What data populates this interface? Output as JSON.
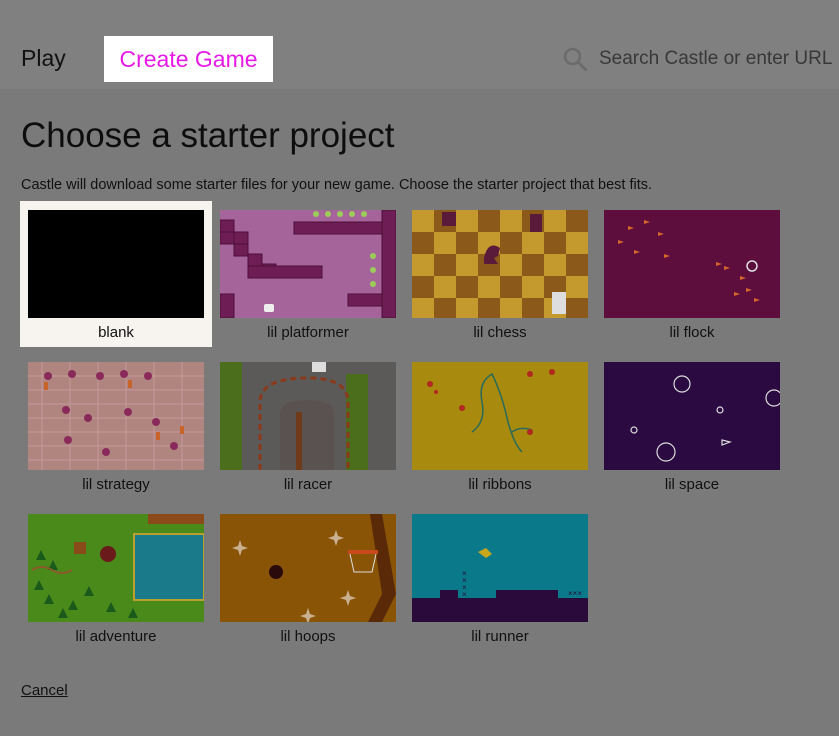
{
  "nav": {
    "play_label": "Play",
    "create_label": "Create Game",
    "search_placeholder": "Search Castle or enter URL"
  },
  "page": {
    "title": "Choose a starter project",
    "subtitle": "Castle will download some starter files for your new game. Choose the starter project that best fits.",
    "cancel_label": "Cancel"
  },
  "projects": [
    {
      "label": "blank",
      "selected": true
    },
    {
      "label": "lil platformer"
    },
    {
      "label": "lil chess"
    },
    {
      "label": "lil flock"
    },
    {
      "label": "lil strategy"
    },
    {
      "label": "lil racer"
    },
    {
      "label": "lil ribbons"
    },
    {
      "label": "lil space"
    },
    {
      "label": "lil adventure"
    },
    {
      "label": "lil hoops"
    },
    {
      "label": "lil runner"
    }
  ],
  "colors": {
    "accent": "#e619e6",
    "overlay_bg": "#7f7f7f",
    "selected_card_bg": "#f7f4f0"
  }
}
